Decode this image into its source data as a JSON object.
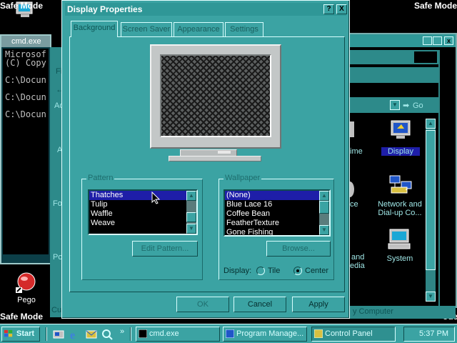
{
  "desktop": {
    "safe_mode_tl": "Safe Mode",
    "safe_mode_tr": "Safe Mode",
    "safe_mode_bl": "Safe Mode",
    "safe_mode_br": "ode",
    "my_computer_label": "My Computer",
    "pego_label": "Pego"
  },
  "cmd": {
    "title": "cmd.exe",
    "lines": "Microsof\n(C) Copy\n\nC:\\Docun\n\nC:\\Docun\n\nC:\\Docun"
  },
  "control_panel": {
    "icons": [
      {
        "name": "Display",
        "label": "Display"
      },
      {
        "name": "Network and Dial-up Connections",
        "label": "Network and Dial-up Co..."
      },
      {
        "name": "System",
        "label": "System"
      }
    ],
    "partial_labels": [
      "ime",
      "ce",
      "and",
      "edia"
    ],
    "go_label": "Go",
    "status": "y Computer"
  },
  "dialog": {
    "title": "Display Properties",
    "help_btn": "?",
    "close_btn": "X",
    "tabs": [
      "Background",
      "Screen Saver",
      "Appearance",
      "Settings"
    ],
    "active_tab": 0,
    "pattern": {
      "label": "Pattern",
      "items": [
        "Thatches",
        "Tulip",
        "Waffle",
        "Weave"
      ],
      "selected": 0,
      "edit_button": "Edit Pattern..."
    },
    "wallpaper": {
      "label": "Wallpaper",
      "items": [
        "(None)",
        "Blue Lace 16",
        "Coffee Bean",
        "FeatherTexture",
        "Gone Fishing"
      ],
      "selected": 0,
      "browse_button": "Browse...",
      "display_label": "Display:",
      "tile_label": "Tile",
      "center_label": "Center",
      "display_mode": "Center"
    },
    "ok_button": "OK",
    "cancel_button": "Cancel",
    "apply_button": "Apply"
  },
  "taskbar": {
    "start_label": "Start",
    "buttons": [
      "cmd.exe",
      "Program Manage...",
      "Control Panel"
    ],
    "clock": "5:37 PM"
  },
  "colors": {
    "dialog_face": "#3ba3a3",
    "selection": "#1e1ea8",
    "listbox_bg": "#000000"
  }
}
